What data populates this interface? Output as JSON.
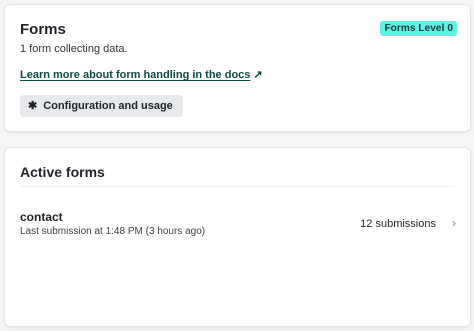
{
  "forms_card": {
    "title": "Forms",
    "badge": "Forms Level 0",
    "summary": "1 form collecting data.",
    "docs_link": "Learn more about form handling in the docs",
    "docs_link_arrow": "↗",
    "config_button": "Configuration and usage",
    "config_icon": "gear-icon"
  },
  "active_forms": {
    "title": "Active forms",
    "items": [
      {
        "name": "contact",
        "last_submission": "Last submission at 1:48 PM (3 hours ago)",
        "count": "12 submissions"
      }
    ]
  },
  "colors": {
    "badge_bg": "#5ff0e6",
    "link": "#0d4b45",
    "button_bg": "#e7e9ec"
  }
}
